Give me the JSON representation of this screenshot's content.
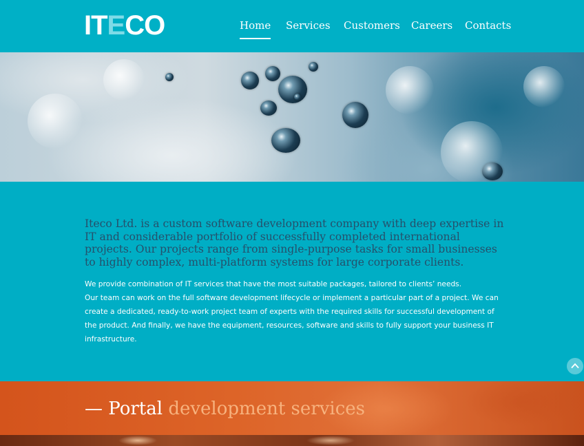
{
  "logo": {
    "part1": "IT",
    "part2": "E",
    "part3": "CO"
  },
  "nav": [
    {
      "label": "Home",
      "active": true
    },
    {
      "label": "Services",
      "active": false
    },
    {
      "label": "Customers",
      "active": false
    },
    {
      "label": "Careers",
      "active": false
    },
    {
      "label": "Contacts",
      "active": false
    }
  ],
  "intro": "Iteco Ltd. is a custom software development company with deep expertise in IT and considerable portfolio of successfully completed international projects. Our projects range from single-purpose tasks for small businesses to highly complex, multi-platform systems for large corporate clients.",
  "body": {
    "p1": "We provide combination of IT services that have the most suitable packages, tailored to clients’ needs.",
    "p2": "Our team can work on the full software development lifecycle or implement a particular part of a project. We can create a dedicated, ready-to-work project team of experts with the required skills for successful development of the product. And finally, we have the equipment, resources, software and skills to fully support your business IT infrastructure."
  },
  "banner": {
    "dash": "— ",
    "title_white": "Portal",
    "title_orange": " development services"
  },
  "icons": {
    "scroll_top": "chevron-up-icon"
  },
  "colors": {
    "header": "#00b0c6",
    "content_bg": "#00aec5",
    "intro_text": "#25506b",
    "banner": "#dd6428",
    "banner_accent": "#f7b27e"
  }
}
